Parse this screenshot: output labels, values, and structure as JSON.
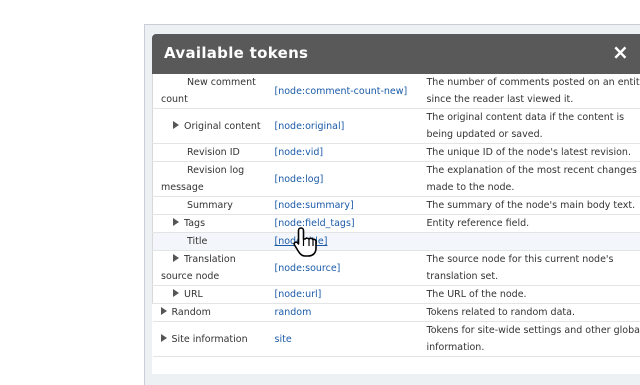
{
  "dialog": {
    "title": "Available tokens",
    "close_label": "×"
  },
  "rows": [
    {
      "name": "New comment count",
      "token": "[node:comment-count-new]",
      "desc": "The number of comments posted on an entity since the reader last viewed it."
    },
    {
      "name": "Original content",
      "token": "[node:original]",
      "desc": "The original content data if the content is being updated or saved."
    },
    {
      "name": "Revision ID",
      "token": "[node:vid]",
      "desc": "The unique ID of the node's latest revision."
    },
    {
      "name": "Revision log message",
      "token": "[node:log]",
      "desc": "The explanation of the most recent changes made to the node."
    },
    {
      "name": "Summary",
      "token": "[node:summary]",
      "desc": "The summary of the node's main body text."
    },
    {
      "name": "Tags",
      "token": "[node:field_tags]",
      "desc": "Entity reference field."
    },
    {
      "name": "Title",
      "token": "[node:title]",
      "desc": ""
    },
    {
      "name": "Translation source node",
      "token": "[node:source]",
      "desc": "The source node for this current node's translation set."
    },
    {
      "name": "URL",
      "token": "[node:url]",
      "desc": "The URL of the node."
    },
    {
      "name": "Random",
      "token": "random",
      "desc": "Tokens related to random data."
    },
    {
      "name": "Site information",
      "token": "site",
      "desc": "Tokens for site-wide settings and other global information."
    }
  ]
}
